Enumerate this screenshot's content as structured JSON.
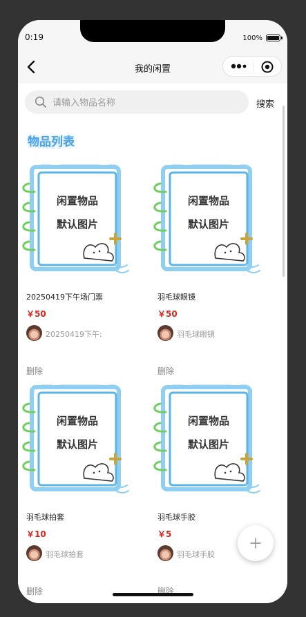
{
  "status": {
    "time": "0:19",
    "battery": "100%"
  },
  "nav": {
    "title": "我的闲置"
  },
  "search": {
    "placeholder": "请输入物品名称",
    "button": "搜索"
  },
  "section": {
    "title": "物品列表",
    "shadow_text": "TRUE"
  },
  "image_placeholder": {
    "line1": "闲置物品",
    "line2": "默认图片"
  },
  "items": [
    {
      "name": "20250419下午场门票",
      "price": "￥50",
      "seller": "20250419下午:",
      "delete": "删除"
    },
    {
      "name": "羽毛球眼镜",
      "price": "￥50",
      "seller": "羽毛球眼镜",
      "delete": "删除"
    },
    {
      "name": "羽毛球拍套",
      "price": "￥10",
      "seller": "羽毛球拍套",
      "delete": "删除"
    },
    {
      "name": "羽毛球手胶",
      "price": "￥5",
      "seller": "羽毛球手胶",
      "delete": "删除"
    }
  ],
  "colors": {
    "accent": "#4aa3e8",
    "price": "#d9251c",
    "background": "#333333"
  },
  "icons": {
    "back": "chevron-left-icon",
    "more": "more-icon",
    "close": "close-circle-icon",
    "search": "search-icon",
    "add": "plus-icon"
  }
}
